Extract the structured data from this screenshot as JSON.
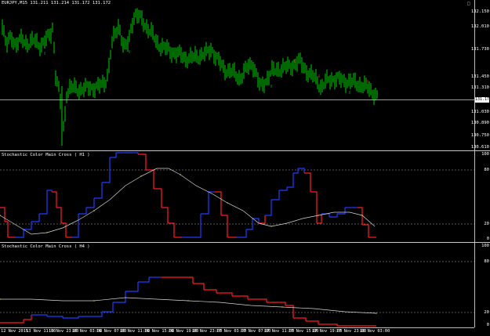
{
  "main": {
    "title": "EURJPY,M15  131.211 131.214 131.172 131.172",
    "current_price": "131.172",
    "price_ticks": [
      "132.150",
      "132.010",
      "131.730",
      "131.450",
      "131.310",
      "131.030",
      "130.890",
      "130.750",
      "130.610"
    ],
    "corner_icon": "chart-corner-icon"
  },
  "sub1": {
    "title": "Stochastic Color Main Cross ( H1 )",
    "levels": [
      "100",
      "80",
      "20",
      "0"
    ]
  },
  "sub2": {
    "title": "Stochastic Color Main Cross ( H4 )",
    "levels": [
      "100",
      "80",
      "20",
      "0"
    ]
  },
  "time_axis": [
    "12 Nov 2015",
    "13 Nov 11:00",
    "13 Nov 23:00",
    "16 Nov 03:00",
    "16 Nov 07:00",
    "16 Nov 11:00",
    "16 Nov 15:00",
    "16 Nov 19:00",
    "16 Nov 23:00",
    "17 Nov 03:00",
    "17 Nov 07:00",
    "17 Nov 11:00",
    "17 Nov 15:00",
    "17 Nov 19:00",
    "17 Nov 23:00",
    "18 Nov 03:00"
  ],
  "colors": {
    "bull": "#00d000",
    "line_blue": "#1e3cff",
    "line_red": "#ff1e1e",
    "signal": "#d8d8d8",
    "signal_dot": "#ffd800",
    "arrow_up": "#00d000",
    "arrow_down": "#ff4040"
  }
}
